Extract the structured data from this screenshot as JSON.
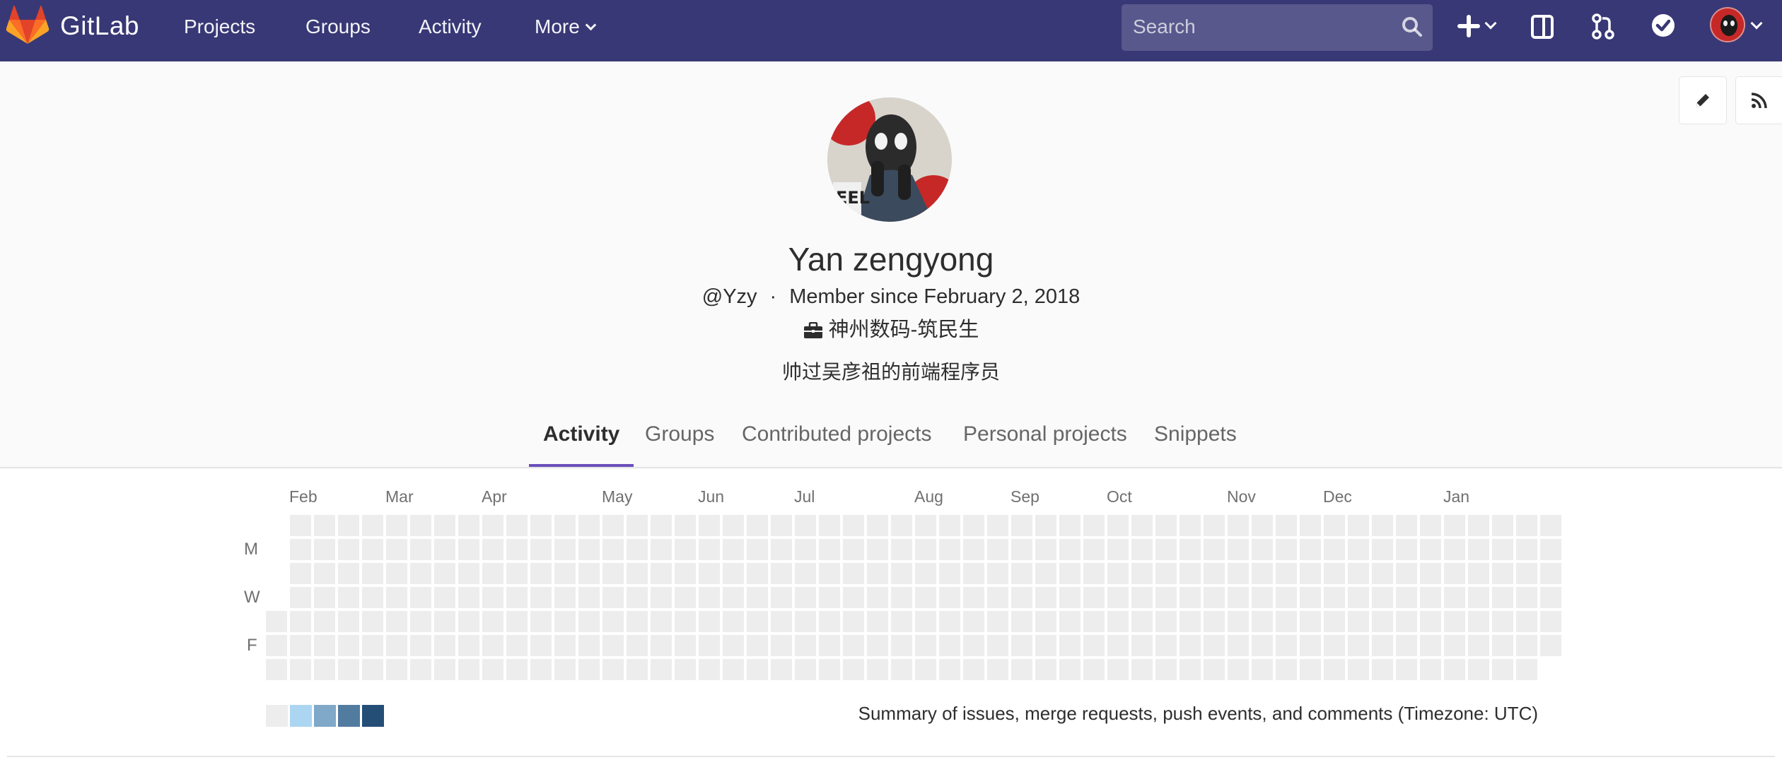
{
  "navbar": {
    "brand": "GitLab",
    "links": [
      "Projects",
      "Groups",
      "Activity",
      "More"
    ],
    "search_placeholder": "Search",
    "colors": {
      "background": "#383876",
      "logo_orange": "#fc6d26"
    }
  },
  "profile": {
    "name": "Yan zengyong",
    "username": "@Yzy",
    "separator": "·",
    "member_since": "Member since February 2, 2018",
    "organization": "神州数码-筑民生",
    "bio": "帅过吴彦祖的前端程序员"
  },
  "tabs": [
    {
      "label": "Activity",
      "active": true
    },
    {
      "label": "Groups",
      "active": false
    },
    {
      "label": "Contributed projects",
      "active": false
    },
    {
      "label": "Personal projects",
      "active": false
    },
    {
      "label": "Snippets",
      "active": false
    }
  ],
  "calendar": {
    "months": [
      "Feb",
      "Mar",
      "Apr",
      "May",
      "Jun",
      "Jul",
      "Aug",
      "Sep",
      "Oct",
      "Nov",
      "Dec",
      "Jan"
    ],
    "day_labels": [
      "M",
      "W",
      "F"
    ],
    "legend_colors": [
      "#ededed",
      "#acd5f2",
      "#7fa8c9",
      "#527ba0",
      "#254e77"
    ],
    "summary": "Summary of issues, merge requests, push events, and comments (Timezone: UTC)",
    "accent": "#6b4fbb"
  }
}
